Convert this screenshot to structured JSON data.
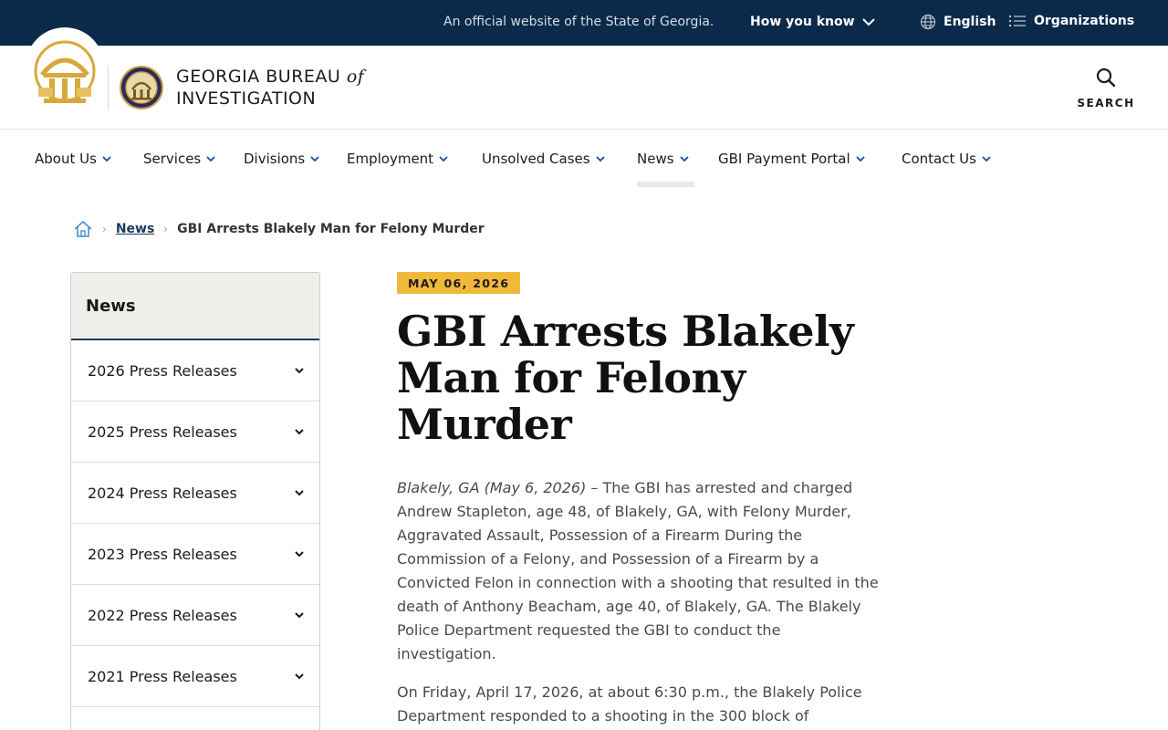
{
  "topbar": {
    "official_text": "An official website of the State of Georgia.",
    "how_you_know": "How you know",
    "language": "English",
    "organizations": "Organizations"
  },
  "header": {
    "agency_line1": "GEORGIA BUREAU",
    "agency_of": "of",
    "agency_line2": "INVESTIGATION",
    "search_label": "SEARCH"
  },
  "nav": {
    "items": [
      {
        "label": "About Us"
      },
      {
        "label": "Services"
      },
      {
        "label": "Divisions"
      },
      {
        "label": "Employment"
      },
      {
        "label": "Unsolved Cases"
      },
      {
        "label": "News"
      },
      {
        "label": "GBI Payment Portal"
      },
      {
        "label": "Contact Us"
      }
    ],
    "active": "News"
  },
  "breadcrumb": {
    "parent": "News",
    "current": "GBI Arrests Blakely Man for Felony Murder"
  },
  "sidebar": {
    "title": "News",
    "items": [
      {
        "label": "2026 Press Releases"
      },
      {
        "label": "2025 Press Releases"
      },
      {
        "label": "2024 Press Releases"
      },
      {
        "label": "2023 Press Releases"
      },
      {
        "label": "2022 Press Releases"
      },
      {
        "label": "2021 Press Releases"
      }
    ]
  },
  "article": {
    "date": "MAY 06, 2026",
    "title": "GBI Arrests Blakely Man for Felony Murder",
    "dateline": "Blakely, GA (May 6, 2026)",
    "paragraph1": " – The GBI has arrested and charged Andrew Stapleton, age 48, of Blakely, GA, with Felony Murder, Aggravated Assault, Possession of a Firearm During the Commission of a Felony, and Possession of a Firearm by a Convicted Felon in connection with a shooting that resulted in the death of Anthony Beacham, age 40, of Blakely, GA. The Blakely Police Department requested the GBI to conduct the investigation.",
    "paragraph2": "On Friday, April 17, 2026, at about 6:30 p.m., the Blakely Police Department responded to a shooting in the 300 block of"
  },
  "colors": {
    "navy": "#0b2a4a",
    "gold": "#f0b93a",
    "link": "#1a3a5c"
  }
}
